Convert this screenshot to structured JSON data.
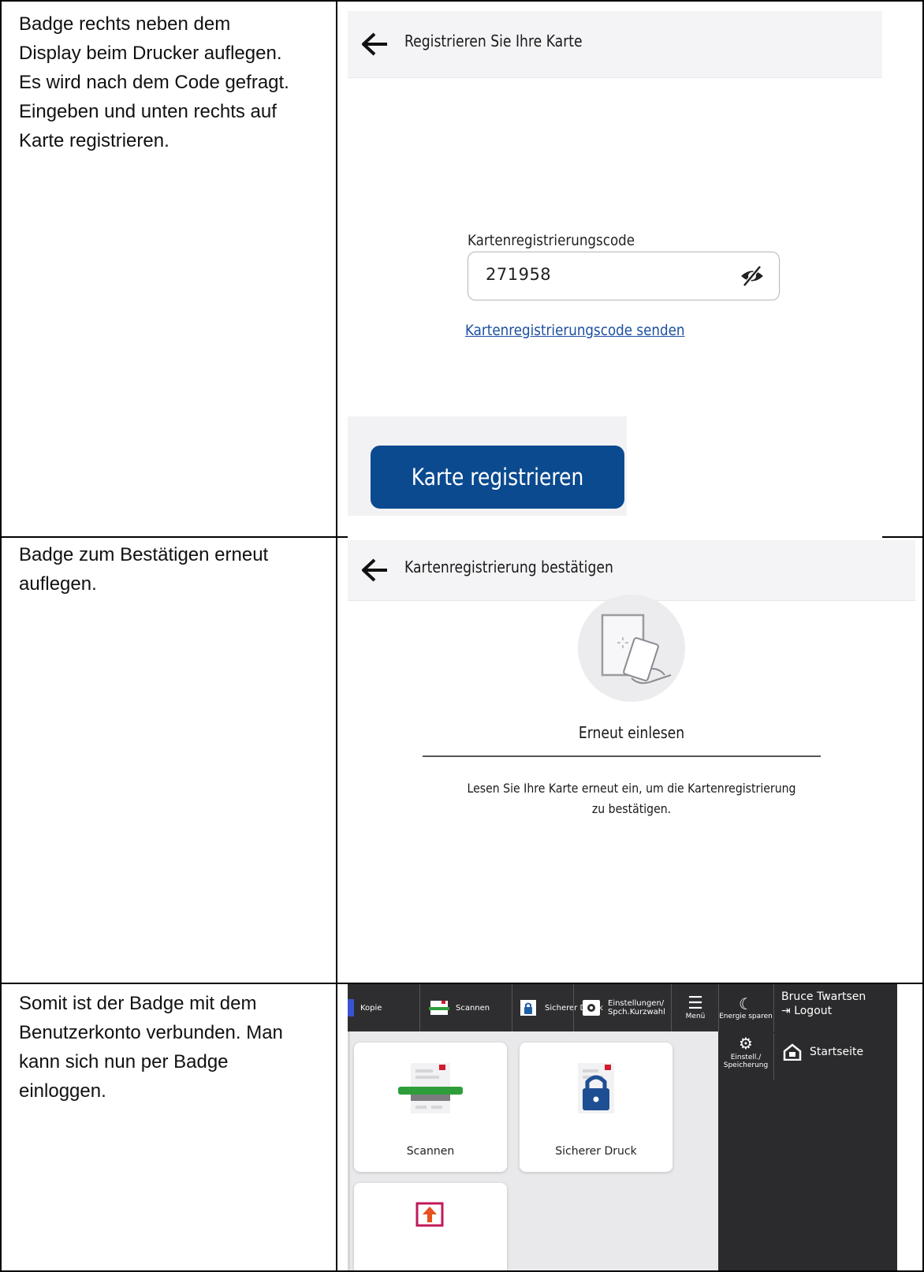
{
  "rows": [
    {
      "text": "Badge rechts neben dem\nDisplay beim Drucker auflegen.\nEs wird nach dem Code gefragt.\nEingeben und unten rechts auf\nKarte registrieren.",
      "screen": {
        "title": "Registrieren Sie Ihre Karte",
        "field_label": "Kartenregistrierungscode",
        "field_value": "271958",
        "link": "Kartenregistrierungscode senden",
        "button": "Karte registrieren"
      }
    },
    {
      "text": "Badge zum Bestätigen erneut\nauflegen.",
      "screen": {
        "title": "Kartenregistrierung bestätigen",
        "heading": "Erneut einlesen",
        "message_line1": "Lesen Sie Ihre Karte erneut ein, um die Kartenregistrierung",
        "message_line2": "zu bestätigen."
      }
    },
    {
      "text": "Somit ist der Badge mit dem\nBenutzerkonto verbunden. Man\nkann sich nun per Badge\neinloggen.",
      "screen": {
        "toolbar": {
          "kopie": "Kopie",
          "scannen": "Scannen",
          "sicherer_druck": "Sicherer Druck",
          "einstellungen_1": "Einstellungen/",
          "einstellungen_2": "Spch.Kurzwahl",
          "menu": "Menü",
          "energie": "Energie sparen",
          "user": "Bruce Twartsen",
          "logout": "Logout"
        },
        "side": {
          "einstell_1": "Einstell./",
          "einstell_2": "Speicherung",
          "startseite": "Startseite"
        },
        "tiles": {
          "scannen": "Scannen",
          "sicherer_druck": "Sicherer Druck"
        }
      }
    }
  ],
  "colors": {
    "primary_button": "#0b4a8f",
    "link": "#1a4fa0",
    "dark_bar": "#2e2e30"
  }
}
